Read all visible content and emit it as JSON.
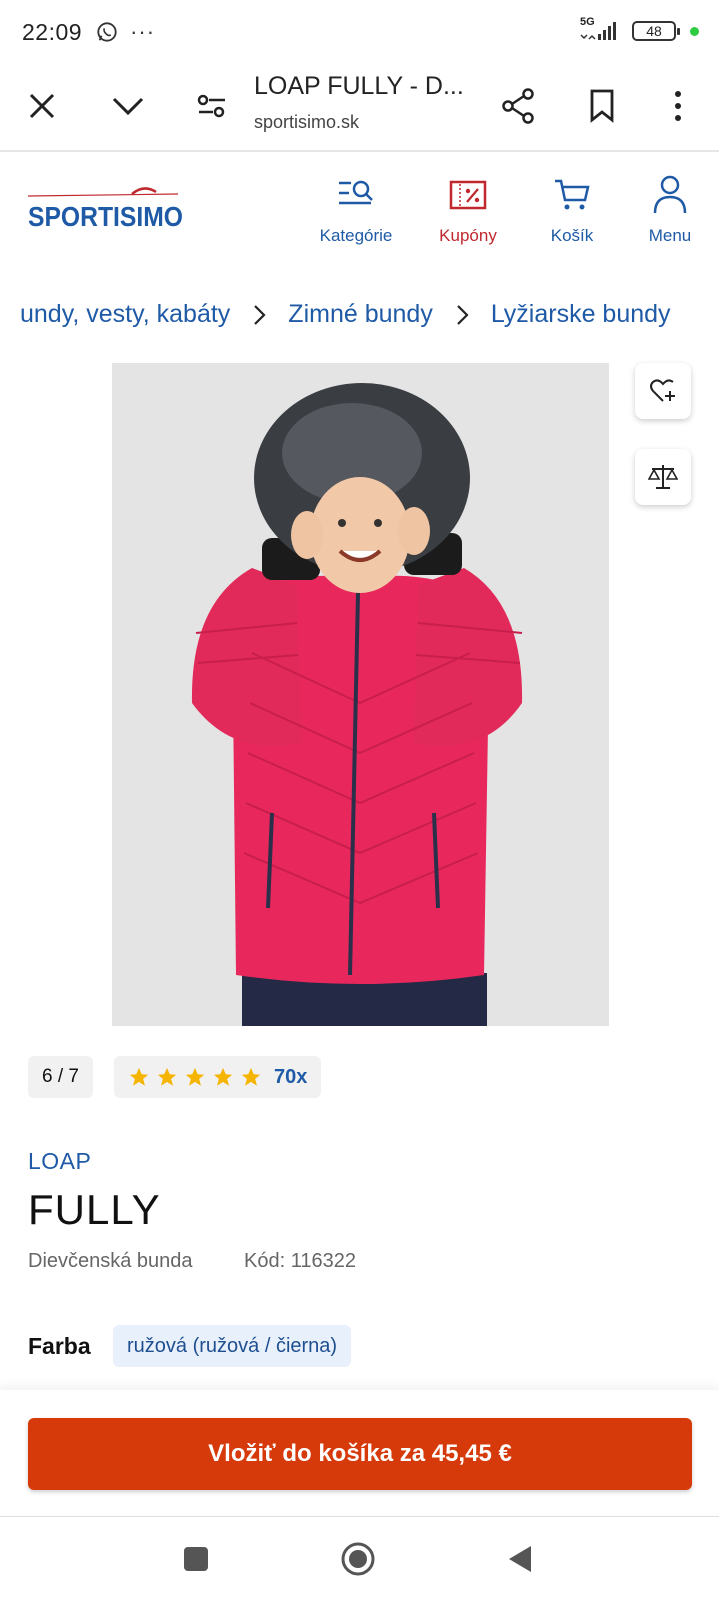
{
  "status_bar": {
    "time": "22:09",
    "more": "···",
    "network": "5G",
    "battery": "48"
  },
  "browser": {
    "title": "LOAP FULLY - D...",
    "url": "sportisimo.sk"
  },
  "site": {
    "logo_text": "SPORTISIMO",
    "nav": [
      {
        "label": "Kategórie",
        "icon": "categories-search-icon"
      },
      {
        "label": "Kupóny",
        "icon": "coupon-percent-icon"
      },
      {
        "label": "Košík",
        "icon": "cart-icon"
      },
      {
        "label": "Menu",
        "icon": "user-icon"
      }
    ]
  },
  "breadcrumb": [
    "undy, vesty, kabáty",
    "Zimné bundy",
    "Lyžiarske bundy"
  ],
  "gallery": {
    "counter": "6 / 7"
  },
  "rating": {
    "stars": 5,
    "count": "70x"
  },
  "product": {
    "brand": "LOAP",
    "name": "FULLY",
    "subtitle": "Dievčenská bunda",
    "code": "Kód: 116322",
    "color_label": "Farba",
    "color_value": "ružová (ružová / čierna)"
  },
  "cart_button": "Vložiť do košíka za 45,45 €",
  "colors": {
    "brand_blue": "#1f5aa6",
    "accent_red": "#c0282d",
    "cart_orange": "#d63a0a",
    "jacket_pink": "#e8285c"
  }
}
